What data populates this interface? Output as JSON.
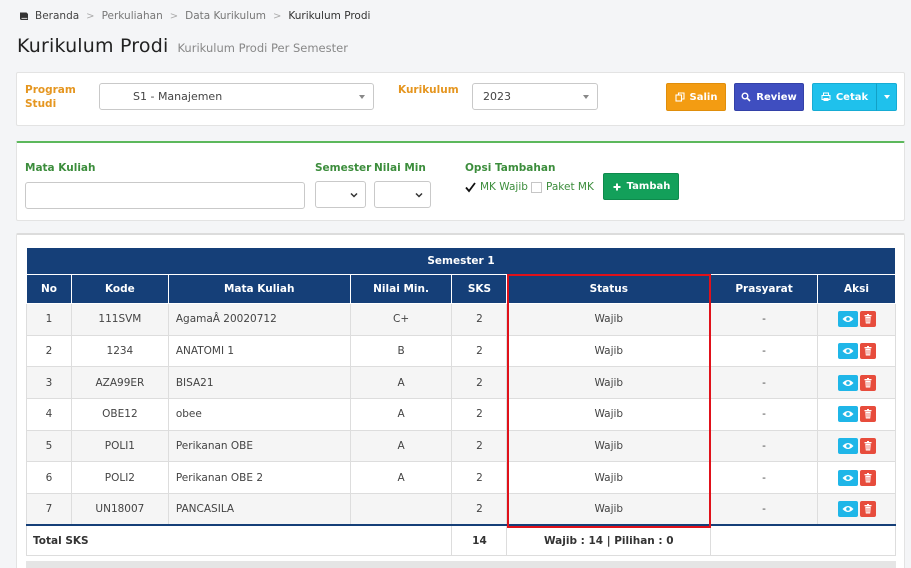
{
  "breadcrumb": [
    "Beranda",
    "Perkuliahan",
    "Data Kurikulum",
    "Kurikulum Prodi"
  ],
  "page": {
    "title": "Kurikulum Prodi",
    "subtitle": "Kurikulum Prodi Per Semester"
  },
  "filter": {
    "program_label_1": "Program",
    "program_label_2": "Studi",
    "program_value": "S1 - Manajemen",
    "kurikulum_label": "Kurikulum",
    "kurikulum_value": "2023",
    "salin_label": "Salin",
    "review_label": "Review",
    "cetak_label": "Cetak"
  },
  "add_form": {
    "mk_label": "Mata Kuliah",
    "mk_value": "",
    "semester_label": "Semester",
    "nilai_label": "Nilai Min",
    "opsi_label": "Opsi Tambahan",
    "mk_wajib_label": "MK Wajib",
    "mk_wajib_checked": true,
    "paket_label": "Paket MK",
    "paket_checked": false,
    "tambah_label": "Tambah"
  },
  "table": {
    "semester_title": "Semester 1",
    "headers": [
      "No",
      "Kode",
      "Mata Kuliah",
      "Nilai Min.",
      "SKS",
      "Status",
      "Prasyarat",
      "Aksi"
    ],
    "rows": [
      {
        "no": "1",
        "kode": "111SVM",
        "mk": "AgamaÂ 20020712",
        "nilai": "C+",
        "sks": "2",
        "status": "Wajib",
        "prasyarat": "-"
      },
      {
        "no": "2",
        "kode": "1234",
        "mk": "ANATOMI 1",
        "nilai": "B",
        "sks": "2",
        "status": "Wajib",
        "prasyarat": "-"
      },
      {
        "no": "3",
        "kode": "AZA99ER",
        "mk": "BISA21",
        "nilai": "A",
        "sks": "2",
        "status": "Wajib",
        "prasyarat": "-"
      },
      {
        "no": "4",
        "kode": "OBE12",
        "mk": "obee",
        "nilai": "A",
        "sks": "2",
        "status": "Wajib",
        "prasyarat": "-"
      },
      {
        "no": "5",
        "kode": "POLI1",
        "mk": "Perikanan OBE",
        "nilai": "A",
        "sks": "2",
        "status": "Wajib",
        "prasyarat": "-"
      },
      {
        "no": "6",
        "kode": "POLI2",
        "mk": "Perikanan OBE 2",
        "nilai": "A",
        "sks": "2",
        "status": "Wajib",
        "prasyarat": "-"
      },
      {
        "no": "7",
        "kode": "UN18007",
        "mk": "PANCASILA",
        "nilai": "",
        "sks": "2",
        "status": "Wajib",
        "prasyarat": "-"
      }
    ],
    "total_label": "Total SKS",
    "total_sks": "14",
    "total_status": "Wajib : 14 | Pilihan : 0"
  },
  "colors": {
    "header_bg": "#153f78",
    "orange_label": "#e59620",
    "green_label": "#3c8d3c",
    "highlight_border": "#e0111a"
  }
}
